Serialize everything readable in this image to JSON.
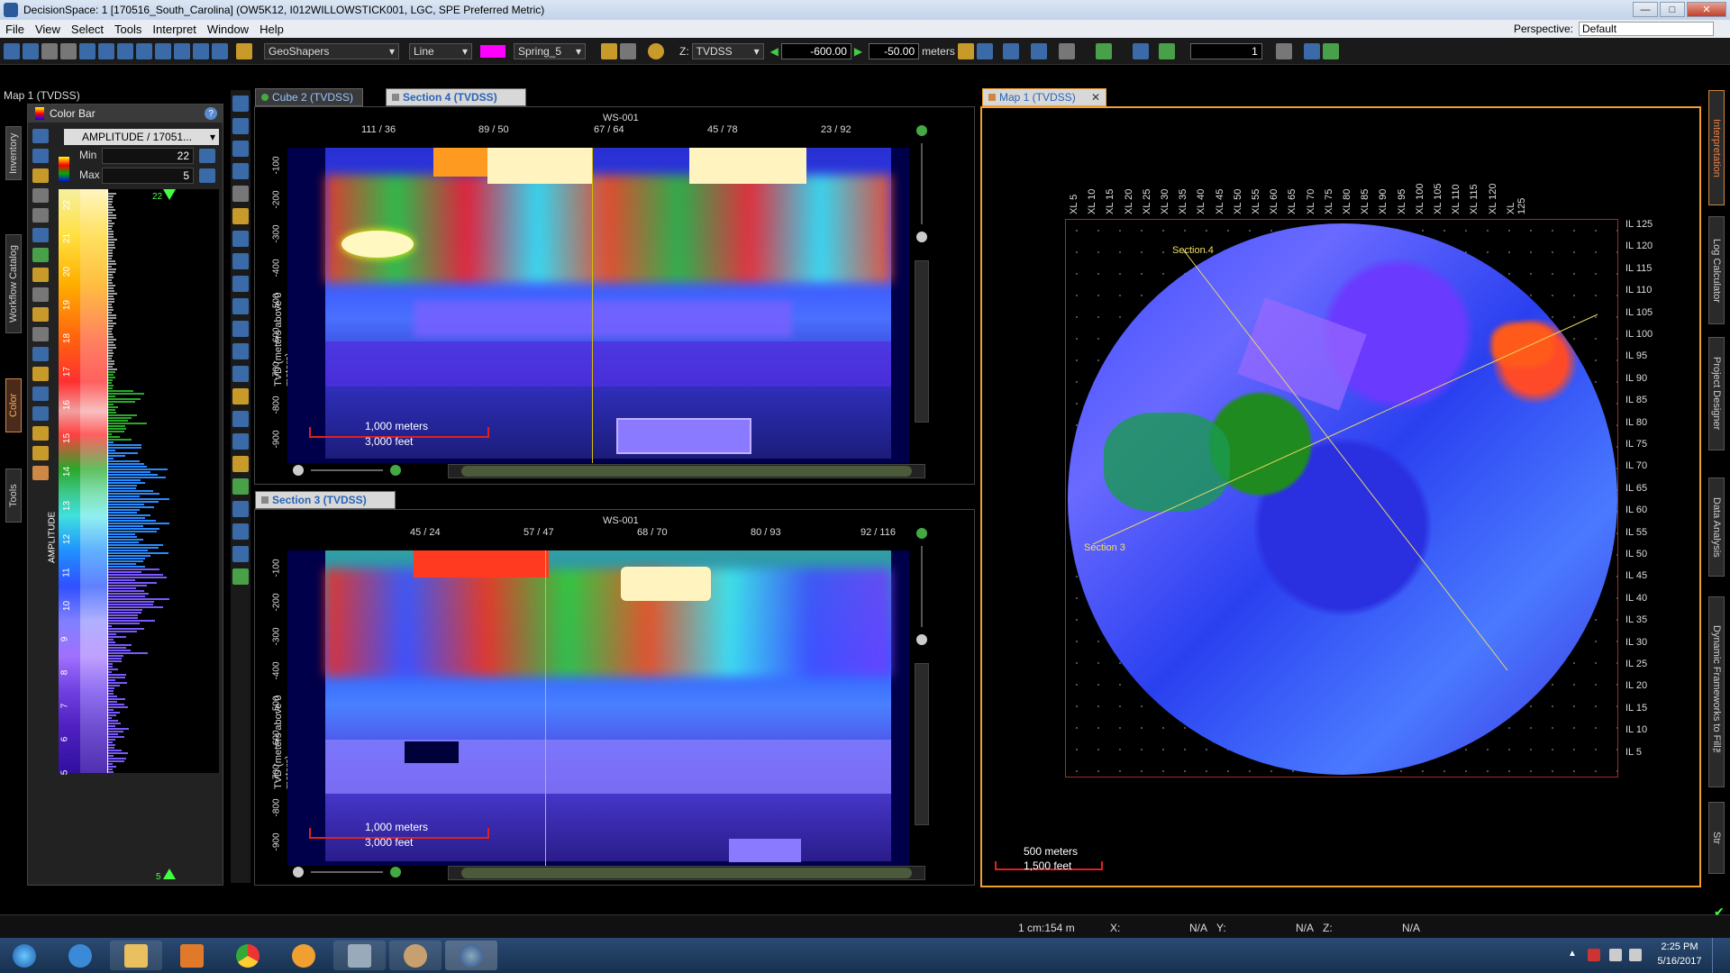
{
  "window": {
    "title": "DecisionSpace: 1 [170516_South_Carolina] (OW5K12, I012WILLOWSTICK001, LGC, SPE Preferred Metric)"
  },
  "menu": {
    "items": [
      "File",
      "View",
      "Select",
      "Tools",
      "Interpret",
      "Window",
      "Help"
    ],
    "perspective_label": "Perspective:",
    "perspective_value": "Default"
  },
  "toolbar": {
    "geoshapers": "GeoShapers",
    "line_style": "Line",
    "colormap": "Spring_5",
    "domain": "TVDSS",
    "domain_prefix": "Z:",
    "depth_min": "-600.00",
    "depth_max": "-50.00",
    "units": "meters",
    "counter": "1",
    "swatch_color": "#ff00ff"
  },
  "left_panel": {
    "title": "Map 1 (TVDSS)",
    "vtabs": [
      "Inventory",
      "Workflow Catalog",
      "Color",
      "Tools"
    ]
  },
  "colorbar": {
    "title": "Color Bar",
    "attribute": "AMPLITUDE / 17051...",
    "min_label": "Min",
    "min_value": "22",
    "max_label": "Max",
    "max_value": "5",
    "axis_label": "AMPLITUDE",
    "scale": [
      "22",
      "21",
      "20",
      "19",
      "18",
      "17",
      "16",
      "15",
      "14",
      "13",
      "12",
      "11",
      "10",
      "9",
      "8",
      "7",
      "6",
      "5"
    ],
    "top_marker": "22",
    "bottom_marker": "5"
  },
  "top_view": {
    "tabs": [
      "Cube 2 (TVDSS)",
      "Section 4 (TVDSS)"
    ],
    "well": "WS-001",
    "ticks": [
      "111 / 36",
      "89 / 50",
      "67 / 64",
      "45 / 78",
      "23 / 92"
    ],
    "ylabel": "TVD (meters above 0 meters)",
    "yticks": [
      "-100",
      "-200",
      "-300",
      "-400",
      "-500",
      "-600",
      "-700",
      "-800",
      "-900"
    ],
    "scale_top": "1,000 meters",
    "scale_bottom": "3,000 feet"
  },
  "bottom_view": {
    "tabs": [
      "Section 3 (TVDSS)"
    ],
    "well": "WS-001",
    "ticks": [
      "45 / 24",
      "57 / 47",
      "68 / 70",
      "80 / 93",
      "92 / 116"
    ],
    "ylabel": "TVD (meters above 0 meters)",
    "yticks": [
      "-100",
      "-200",
      "-300",
      "-400",
      "-500",
      "-600",
      "-700",
      "-800",
      "-900"
    ],
    "scale_top": "1,000 meters",
    "scale_bottom": "3,000 feet"
  },
  "map_view": {
    "tab": "Map 1 (TVDSS)",
    "xl": [
      "XL 5",
      "XL 10",
      "XL 15",
      "XL 20",
      "XL 25",
      "XL 30",
      "XL 35",
      "XL 40",
      "XL 45",
      "XL 50",
      "XL 55",
      "XL 60",
      "XL 65",
      "XL 70",
      "XL 75",
      "XL 80",
      "XL 85",
      "XL 90",
      "XL 95",
      "XL 100",
      "XL 105",
      "XL 110",
      "XL 115",
      "XL 120",
      "XL 125"
    ],
    "il": [
      "IL 125",
      "IL 120",
      "IL 115",
      "IL 110",
      "IL 105",
      "IL 100",
      "IL 95",
      "IL 90",
      "IL 85",
      "IL 80",
      "IL 75",
      "IL 70",
      "IL 65",
      "IL 60",
      "IL 55",
      "IL 50",
      "IL 45",
      "IL 40",
      "IL 35",
      "IL 30",
      "IL 25",
      "IL 20",
      "IL 15",
      "IL 10",
      "IL 5"
    ],
    "section4": "Section 4",
    "section3": "Section 3",
    "scale_top": "500 meters",
    "scale_bottom": "1,500 feet"
  },
  "right_tabs": [
    "Interpretation",
    "Log Calculator",
    "Project Designer",
    "Data Analysis",
    "Dynamic Frameworks to Fill™",
    "Str"
  ],
  "status": {
    "scale": "1 cm:154 m",
    "x_label": "X:",
    "x_value": "N/A",
    "y_label": "Y:",
    "y_value": "N/A",
    "z_label": "Z:",
    "z_value": "N/A"
  },
  "taskbar": {
    "time": "2:25 PM",
    "date": "5/16/2017"
  }
}
